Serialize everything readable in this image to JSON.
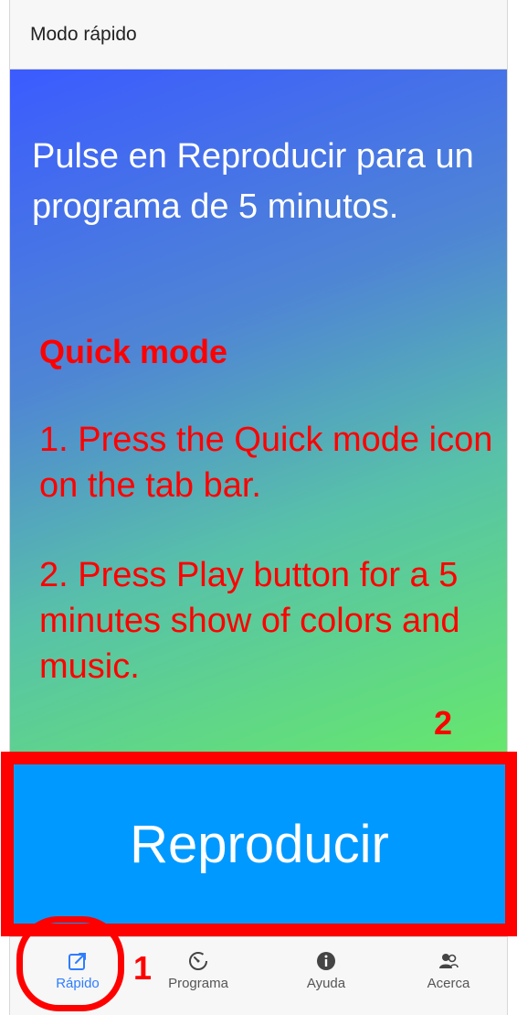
{
  "header": {
    "title": "Modo rápido"
  },
  "main": {
    "message": "Pulse en Reproducir para un programa de 5 minutos."
  },
  "overlay": {
    "title": "Quick mode",
    "step1": "1. Press the Quick mode icon on the tab bar.",
    "step2": "2. Press Play button for a 5 minutes show of colors and music.",
    "marker_play": "2",
    "marker_tab": "1"
  },
  "play_button": {
    "label": "Reproducir"
  },
  "tabs": [
    {
      "label": "Rápido",
      "icon": "external-link-icon",
      "active": true
    },
    {
      "label": "Programa",
      "icon": "timer-icon",
      "active": false
    },
    {
      "label": "Ayuda",
      "icon": "info-icon",
      "active": false
    },
    {
      "label": "Acerca",
      "icon": "people-icon",
      "active": false
    }
  ],
  "colors": {
    "accent": "#2f7dff",
    "play": "#0099ff",
    "annotation": "#ff0000"
  }
}
